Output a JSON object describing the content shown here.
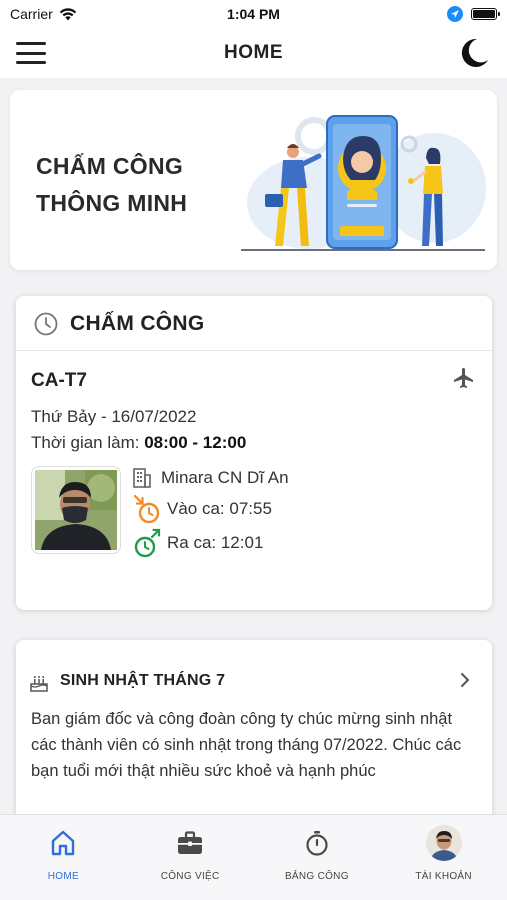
{
  "status_bar": {
    "carrier": "Carrier",
    "time": "1:04 PM"
  },
  "header": {
    "title": "HOME"
  },
  "banner": {
    "headline_line1": "CHẤM CÔNG",
    "headline_line2": "THÔNG MINH"
  },
  "attendance": {
    "section_title": "CHẤM CÔNG",
    "shift_code": "CA-T7",
    "date": "Thứ Bảy - 16/07/2022",
    "work_time_label": "Thời gian làm: ",
    "work_time_value": "08:00 - 12:00",
    "location": "Minara CN Dĩ An",
    "check_in": "Vào ca: 07:55",
    "check_out": "Ra ca: 12:01",
    "colors": {
      "check_in": "#f08a24",
      "check_out": "#1e9e4a"
    }
  },
  "birthday": {
    "title": "SINH NHẬT THÁNG 7",
    "message": "Ban giám đốc và công đoàn công ty chúc mừng sinh nhật các thành viên có sinh nhật trong tháng 07/2022. Chúc các bạn tuổi mới thật nhiều sức khoẻ và hạnh phúc"
  },
  "bottom_nav": [
    {
      "label": "HOME",
      "icon": "home-icon",
      "active": true
    },
    {
      "label": "CÔNG VIỆC",
      "icon": "briefcase-icon",
      "active": false
    },
    {
      "label": "BẢNG CÔNG",
      "icon": "stopwatch-icon",
      "active": false
    },
    {
      "label": "TÀI KHOẢN",
      "icon": "avatar",
      "active": false
    }
  ],
  "theme": {
    "accent": "#2f6fdb",
    "illustration_blue": "#4a90e2",
    "illustration_yellow": "#f5c518"
  }
}
